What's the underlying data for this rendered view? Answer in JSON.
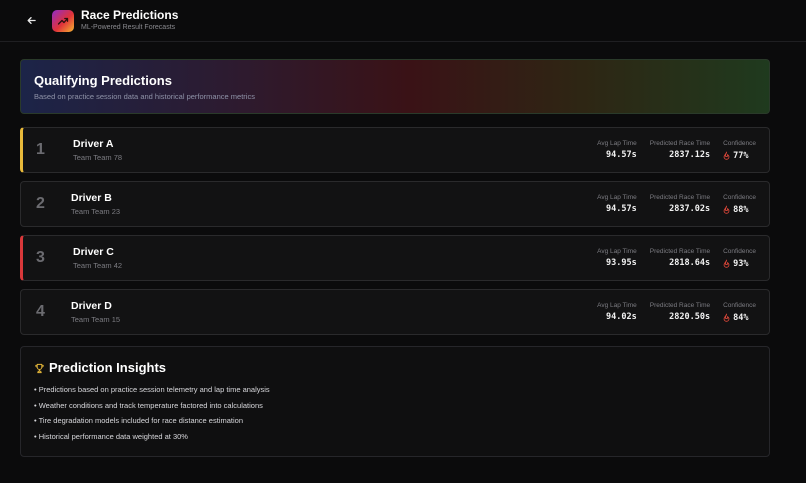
{
  "header": {
    "title": "Race Predictions",
    "subtitle": "ML-Powered Result Forecasts",
    "back_icon": "arrow-left-icon",
    "logo_icon": "trending-up-icon"
  },
  "banner": {
    "title": "Qualifying Predictions",
    "subtitle": "Based on practice session data and historical performance metrics"
  },
  "labels": {
    "avg_lap": "Avg Lap Time",
    "pred_race": "Predicted Race Time",
    "confidence": "Confidence"
  },
  "drivers": [
    {
      "position": "1",
      "name": "Driver A",
      "team": "Team Team 78",
      "avg_lap": "94.57s",
      "race_time": "2837.12s",
      "confidence": "77%",
      "accent": "#e8b93a"
    },
    {
      "position": "2",
      "name": "Driver B",
      "team": "Team Team 23",
      "avg_lap": "94.57s",
      "race_time": "2837.02s",
      "confidence": "88%",
      "accent": ""
    },
    {
      "position": "3",
      "name": "Driver C",
      "team": "Team Team 42",
      "avg_lap": "93.95s",
      "race_time": "2818.64s",
      "confidence": "93%",
      "accent": "#d9383a"
    },
    {
      "position": "4",
      "name": "Driver D",
      "team": "Team Team 15",
      "avg_lap": "94.02s",
      "race_time": "2820.50s",
      "confidence": "84%",
      "accent": ""
    }
  ],
  "insights": {
    "title": "Prediction Insights",
    "icon": "trophy-icon",
    "items": [
      "Predictions based on practice session telemetry and lap time analysis",
      "Weather conditions and track temperature factored into calculations",
      "Tire degradation models included for race distance estimation",
      "Historical performance data weighted at 30%"
    ]
  },
  "colors": {
    "background": "#0b0b0c",
    "card": "#121213",
    "flame": "#e0483a",
    "gold": "#e8b93a",
    "red": "#d9383a"
  }
}
